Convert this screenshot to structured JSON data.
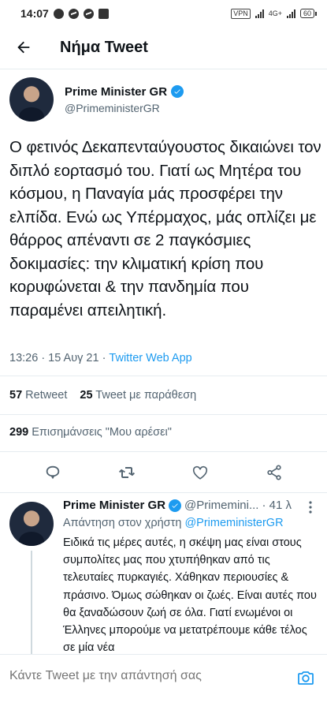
{
  "status_bar": {
    "time": "14:07",
    "vpn": "VPN",
    "network": "4G+",
    "battery": "60"
  },
  "header": {
    "title": "Νήμα Tweet"
  },
  "tweet": {
    "display_name": "Prime Minister GR",
    "handle": "@PrimeministerGR",
    "text": "Ο φετινός Δεκαπενταύγουστος δικαιώνει τον διπλό εορτασμό του. Γιατί ως Μητέρα του κόσμου, η Παναγία μάς προσφέρει την ελπίδα. Ενώ ως Υπέρμαχος, μάς οπλίζει με θάρρος απέναντι σε 2 παγκόσμιες δοκιμασίες: την κλιματική κρίση που κορυφώνεται & την πανδημία που παραμένει απειλητική.",
    "timestamp": "13:26 · 15 Αυγ 21 · ",
    "source": "Twitter Web App",
    "retweets_count": "57",
    "retweets_label": "Retweet",
    "quotes_count": "25",
    "quotes_label": "Tweet με παράθεση",
    "likes_count": "299",
    "likes_label": "Επισημάνσεις \"Μου αρέσει\""
  },
  "reply": {
    "display_name": "Prime Minister GR",
    "handle": "@Primemini...",
    "time": "· 41 λ",
    "reply_to_prefix": "Απάντηση στον χρήστη ",
    "reply_to_handle": "@PrimeministerGR",
    "text": "Ειδικά τις μέρες αυτές, η σκέψη μας είναι στους συμπολίτες μας που χτυπήθηκαν από τις τελευταίες πυρκαγιές. Χάθηκαν περιουσίες & πράσινο. Όμως σώθηκαν οι ζωές. Είναι αυτές που θα ξαναδώσουν ζωή σε όλα. Γιατί ενωμένοι οι Έλληνες μπορούμε να μετατρέπουμε κάθε τέλος σε μία νέα"
  },
  "composer": {
    "placeholder": "Κάντε Tweet με την απάντησή σας"
  },
  "colors": {
    "accent": "#1d9bf0",
    "text_primary": "#0f1419",
    "text_secondary": "#536471",
    "divider": "#e6ecf0"
  },
  "icons": {
    "back": "arrow-left-icon",
    "verified": "verified-badge-icon",
    "reply": "comment-icon",
    "retweet": "retweet-icon",
    "like": "heart-icon",
    "share": "share-icon",
    "more": "more-vertical-icon",
    "camera": "camera-icon"
  }
}
